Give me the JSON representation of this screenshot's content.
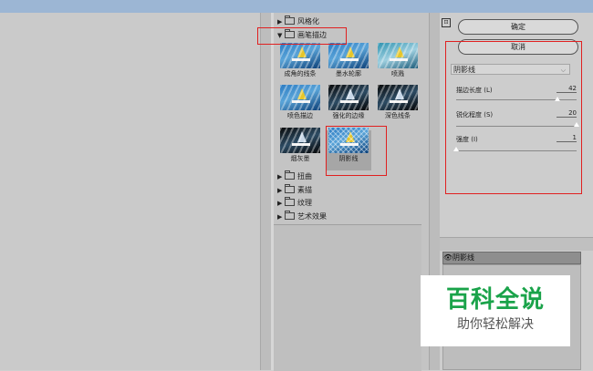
{
  "gallery": {
    "folders_top": [
      {
        "label": "风格化",
        "expanded": false
      },
      {
        "label": "画笔描边",
        "expanded": true
      }
    ],
    "filters": [
      {
        "label": "成角的线条",
        "style": "default"
      },
      {
        "label": "墨水轮廓",
        "style": "default"
      },
      {
        "label": "喷溅",
        "style": "teal"
      },
      {
        "label": "喷色描边",
        "style": "default"
      },
      {
        "label": "强化的边缘",
        "style": "dark"
      },
      {
        "label": "深色线条",
        "style": "dark"
      },
      {
        "label": "烟灰墨",
        "style": "dark"
      },
      {
        "label": "阴影线",
        "style": "cross",
        "selected": true
      }
    ],
    "folders_bottom": [
      {
        "label": "扭曲"
      },
      {
        "label": "素描"
      },
      {
        "label": "纹理"
      },
      {
        "label": "艺术效果"
      }
    ]
  },
  "controls": {
    "collapse_icon": "⊡",
    "ok_label": "确定",
    "cancel_label": "取消",
    "filter_select": "阴影线",
    "params": [
      {
        "label": "描边长度 (L)",
        "value": "42",
        "fraction": 0.84
      },
      {
        "label": "锐化程度 (S)",
        "value": "20",
        "fraction": 1.0
      },
      {
        "label": "强度 (I)",
        "value": "1",
        "fraction": 0.0
      }
    ],
    "layer_name": "阴影线"
  },
  "watermark": {
    "title": "百科全说",
    "subtitle": "助你轻松解决"
  }
}
